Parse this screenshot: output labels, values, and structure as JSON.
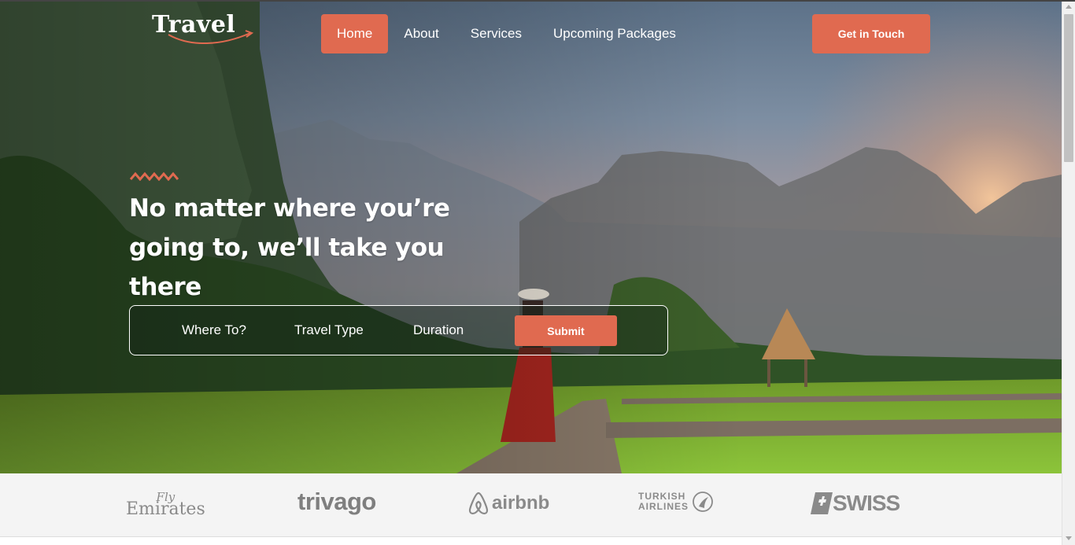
{
  "brand": {
    "logo_text": "Travel",
    "accent_color": "#e06a50"
  },
  "nav": {
    "items": [
      {
        "label": "Home",
        "active": true
      },
      {
        "label": "About",
        "active": false
      },
      {
        "label": "Services",
        "active": false
      },
      {
        "label": "Upcoming Packages",
        "active": false
      }
    ],
    "cta_label": "Get in Touch"
  },
  "hero": {
    "headline": "No matter where you’re going to, we’ll take you there",
    "search": {
      "fields": [
        "Where To?",
        "Travel Type",
        "Duration"
      ],
      "submit_label": "Submit"
    }
  },
  "partners": {
    "emirates_line1": "Fly",
    "emirates_line2": "Emirates",
    "trivago": "trivago",
    "airbnb": "airbnb",
    "turkish_line1": "TURKISH",
    "turkish_line2": "AIRLINES",
    "swiss": "SWISS"
  }
}
